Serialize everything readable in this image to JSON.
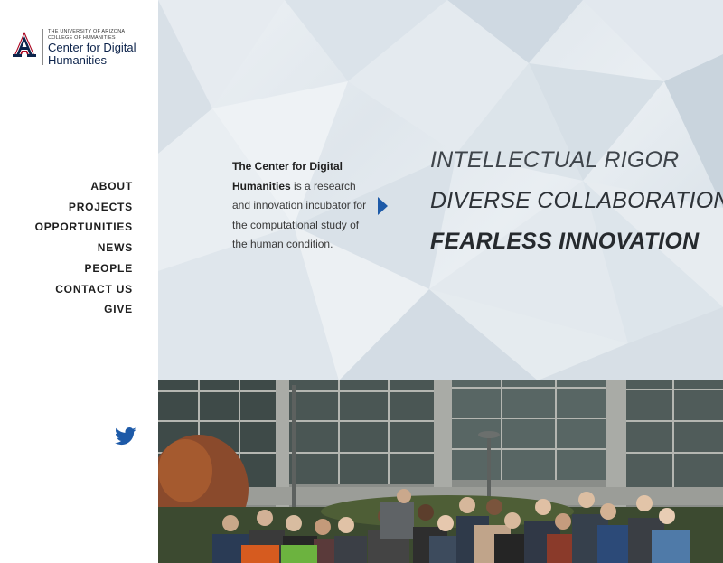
{
  "logo": {
    "line1": "THE UNIVERSITY OF ARIZONA",
    "line2": "COLLEGE OF HUMANITIES",
    "name_line1": "Center for Digital",
    "name_line2": "Humanities"
  },
  "nav": {
    "items": [
      "ABOUT",
      "PROJECTS",
      "OPPORTUNITIES",
      "NEWS",
      "PEOPLE",
      "CONTACT US",
      "GIVE"
    ]
  },
  "hero": {
    "intro_bold": "The Center for Digital Humanities",
    "intro_rest": " is a research and innovation incubator for the computational study of the human condition.",
    "tagline_1": "INTELLECTUAL RIGOR",
    "tagline_2": "DIVERSE COLLABORATION",
    "tagline_3": "FEARLESS INNOVATION"
  },
  "colors": {
    "brand_navy": "#0c234b",
    "brand_red": "#ab0520",
    "twitter_blue": "#1d5aa8"
  },
  "icons": {
    "logo": "block-a-logo",
    "social": "twitter-icon",
    "arrow": "chevron-right-icon"
  }
}
